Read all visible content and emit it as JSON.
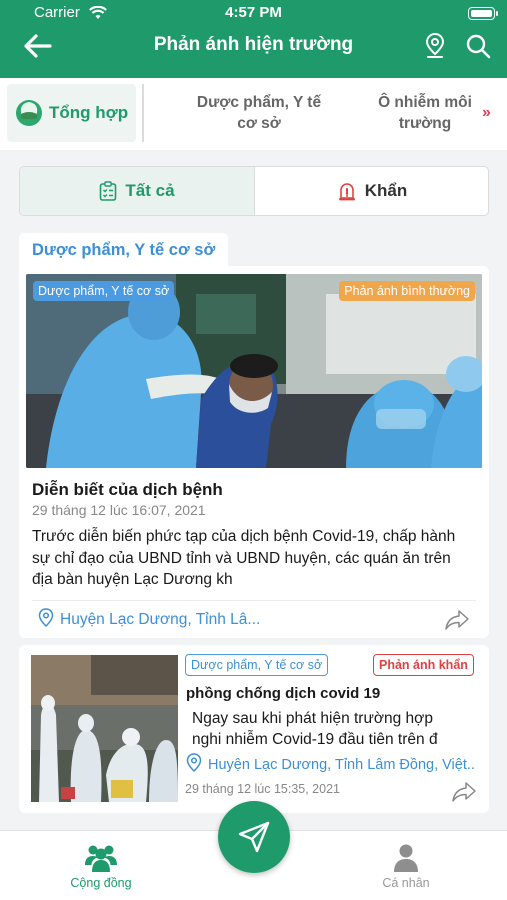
{
  "status_bar": {
    "carrier": "Carrier",
    "time": "4:57 PM"
  },
  "header": {
    "title": "Phản ánh hiện trường"
  },
  "category_tabs": [
    {
      "label": "Tổng hợp",
      "active": true
    },
    {
      "label": "Dược phẩm, Y tế cơ sở",
      "active": false
    },
    {
      "label": "Ô nhiễm môi trường",
      "active": false
    }
  ],
  "category_more": "»",
  "filter": {
    "all_label": "Tất cả",
    "urgent_label": "Khẩn",
    "selected": "all"
  },
  "section": {
    "label": "Dược phẩm, Y tế cơ sở"
  },
  "posts": [
    {
      "category": "Dược phẩm, Y tế cơ sở",
      "type": "Phản ánh bình thường",
      "title": "Diễn biết của dịch bệnh",
      "date": "29 tháng 12 lúc 16:07, 2021",
      "description": "Trước diễn biến phức tạp của dịch bệnh Covid-19, chấp hành sự chỉ đạo của UBND tỉnh và UBND huyện, các quán ăn trên địa bàn huyện Lạc Dương kh",
      "location": "Huyện Lạc Dương, Tỉnh Lâ..."
    },
    {
      "category": "Dược phẩm, Y tế cơ sở",
      "type": "Phản ánh khẩn",
      "title": "phồng chống dịch covid 19",
      "description_lines": [
        "Ngay sau khi phát hiện trường hợp",
        "nghi nhiễm Covid-19 đầu tiên trên đ"
      ],
      "location": "Huyện Lạc Dương, Tỉnh Lâm Đồng, Việt...",
      "date": "29 tháng 12 lúc 15:35, 2021"
    }
  ],
  "bottom_nav": {
    "community": "Cộng đồng",
    "personal": "Cá nhân"
  },
  "colors": {
    "primary": "#1f9b6b",
    "link": "#3d8fd6",
    "urgent": "#e04242",
    "normal": "#f0a64a"
  }
}
